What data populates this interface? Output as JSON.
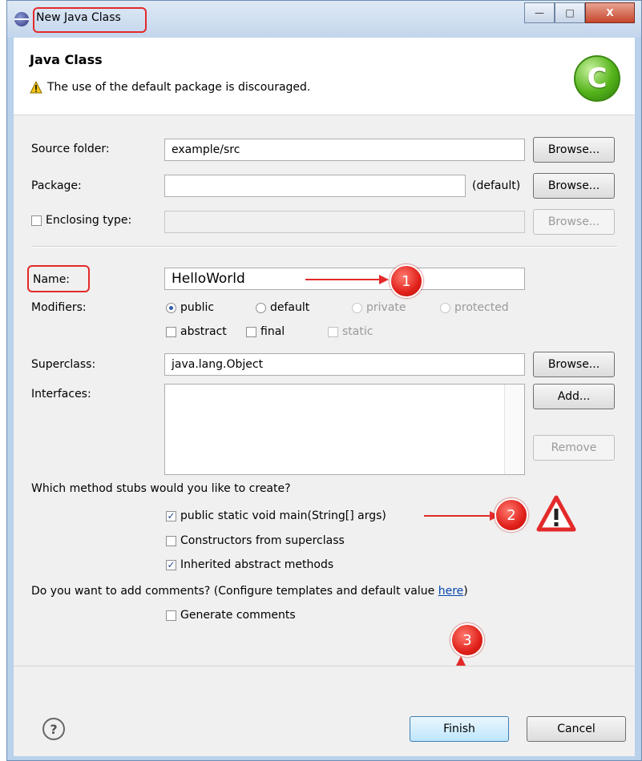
{
  "window": {
    "title": "New Java Class",
    "controls": {
      "minimize": "—",
      "maximize": "□",
      "close": "X"
    }
  },
  "header": {
    "title": "Java Class",
    "message": "The use of the default package is discouraged.",
    "icon": "java-class-c-icon"
  },
  "form": {
    "source_folder": {
      "label": "Source folder:",
      "value": "example/src",
      "button": "Browse..."
    },
    "package": {
      "label": "Package:",
      "value": "",
      "suffix": "(default)",
      "button": "Browse..."
    },
    "enclosing": {
      "label": "Enclosing type:",
      "value": "",
      "button": "Browse..."
    },
    "name": {
      "label": "Name:",
      "value": "HelloWorld"
    },
    "modifiers": {
      "label": "Modifiers:",
      "radios": [
        "public",
        "default",
        "private",
        "protected"
      ],
      "checks": [
        "abstract",
        "final",
        "static"
      ]
    },
    "superclass": {
      "label": "Superclass:",
      "value": "java.lang.Object",
      "button": "Browse..."
    },
    "interfaces": {
      "label": "Interfaces:",
      "add_button": "Add...",
      "remove_button": "Remove"
    },
    "stubs": {
      "question": "Which method stubs would you like to create?",
      "options": [
        "public static void main(String[] args)",
        "Constructors from superclass",
        "Inherited abstract methods"
      ]
    },
    "comments": {
      "question_prefix": "Do you want to add comments? (Configure templates and default value ",
      "link": "here",
      "question_suffix": ")",
      "option": "Generate comments"
    }
  },
  "annotations": {
    "step1": "1",
    "step2": "2",
    "step3": "3"
  },
  "footer": {
    "help": "?",
    "finish": "Finish",
    "cancel": "Cancel"
  },
  "colors": {
    "annotation_red": "#e32a2a",
    "title_bar": "#c3d6ed"
  }
}
